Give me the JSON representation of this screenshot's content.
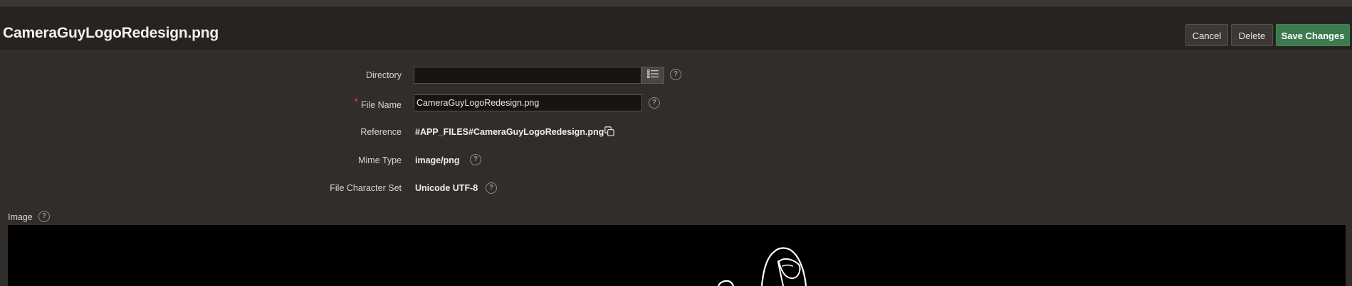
{
  "header": {
    "title": "CameraGuyLogoRedesign.png",
    "cancel_label": "Cancel",
    "delete_label": "Delete",
    "save_label": "Save Changes"
  },
  "form": {
    "directory": {
      "label": "Directory",
      "value": ""
    },
    "file_name": {
      "label": "File Name",
      "value": "CameraGuyLogoRedesign.png",
      "required_mark": "*"
    },
    "reference": {
      "label": "Reference",
      "value": "#APP_FILES#CameraGuyLogoRedesign.png"
    },
    "mime_type": {
      "label": "Mime Type",
      "value": "image/png"
    },
    "file_character_set": {
      "label": "File Character Set",
      "value": "Unicode UTF-8"
    }
  },
  "image": {
    "label": "Image"
  },
  "help_glyph": "?",
  "icons": [
    "list-icon",
    "help-icon",
    "copy-icon"
  ],
  "colors": {
    "accent_save": "#3d7a4d",
    "required": "#e0463e",
    "background": "#302d2a"
  }
}
